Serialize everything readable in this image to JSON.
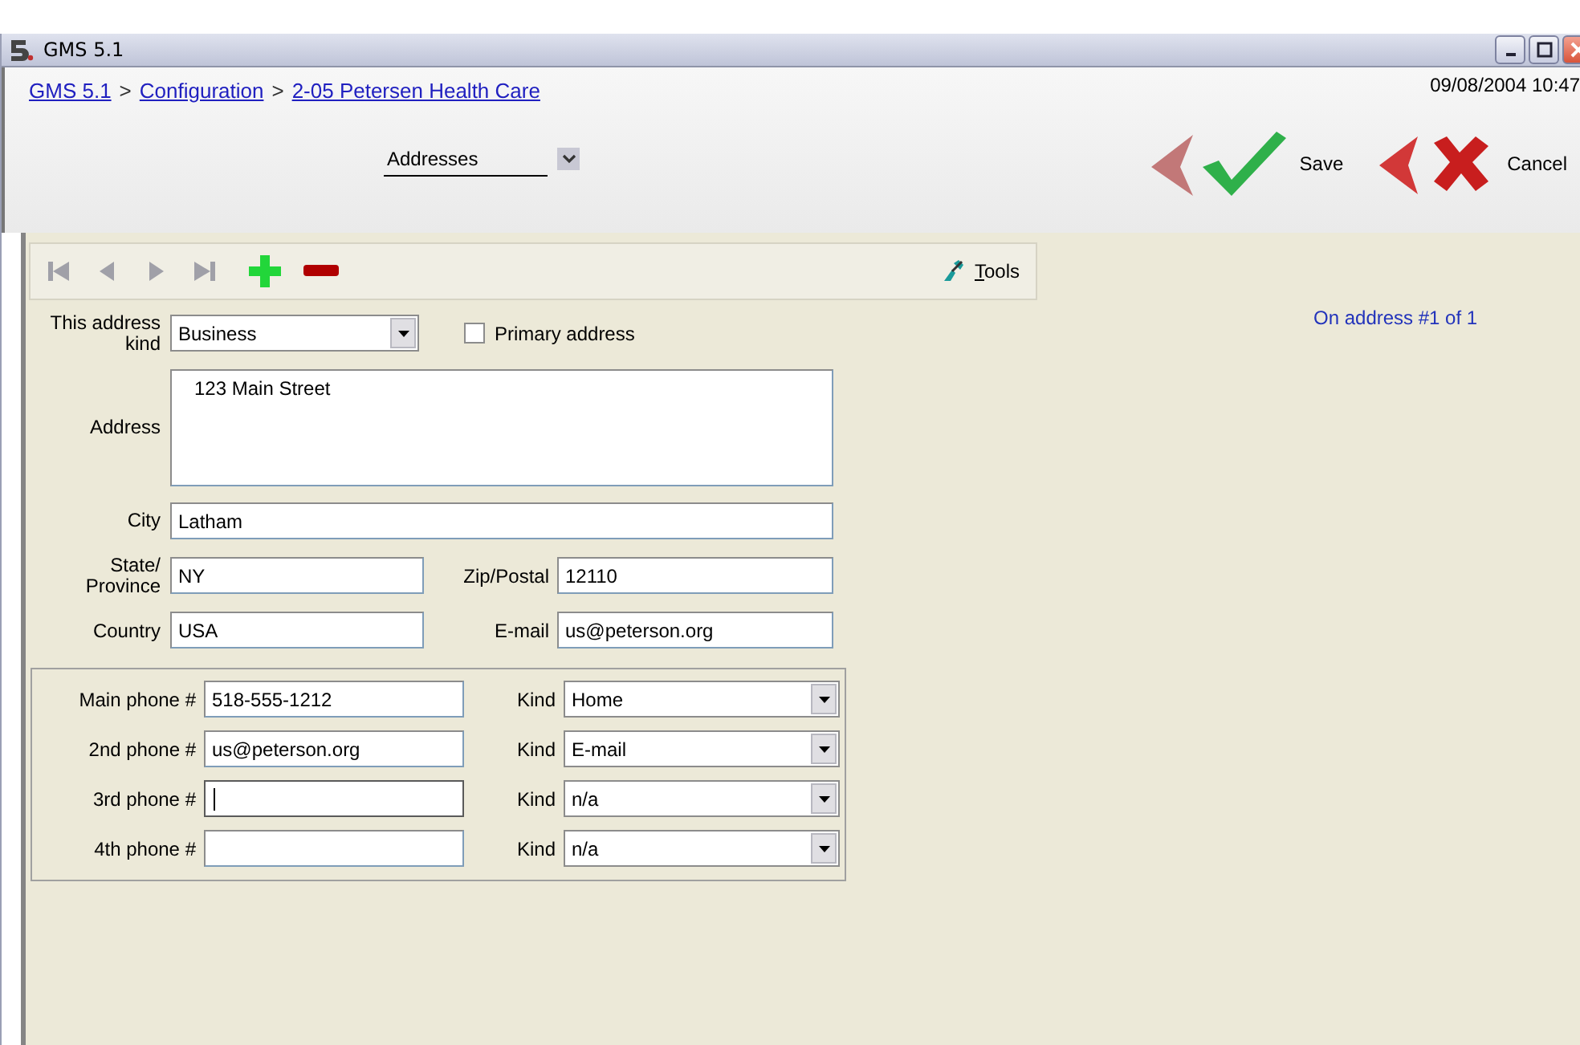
{
  "window": {
    "title": "GMS 5.1"
  },
  "header": {
    "breadcrumb": [
      {
        "kind": "link",
        "text": "GMS 5.1"
      },
      {
        "kind": "separator",
        "text": ">"
      },
      {
        "kind": "link",
        "text": "Configuration"
      },
      {
        "kind": "separator",
        "text": ">"
      },
      {
        "kind": "link",
        "text": "2-05 Petersen Health Care"
      }
    ],
    "section_select": {
      "value": "Addresses"
    },
    "datetime": "09/08/2004 10:47",
    "actions": [
      {
        "kind": "save",
        "label": "Save"
      },
      {
        "kind": "cancel",
        "label": "Cancel"
      }
    ]
  },
  "toolbar": {
    "nav": [
      {
        "kind": "first",
        "disabled": true
      },
      {
        "kind": "previous",
        "disabled": true
      },
      {
        "kind": "next",
        "disabled": true
      },
      {
        "kind": "last",
        "disabled": true
      }
    ],
    "tools": {
      "label": "Tools"
    }
  },
  "record_position": "On address #1 of 1",
  "form": {
    "address_kind": {
      "label": "This address kind",
      "value": "Business"
    },
    "primary_address": {
      "label": "Primary address",
      "checked": false
    },
    "address": {
      "label": "Address",
      "value": "123 Main Street"
    },
    "city": {
      "label": "City",
      "value": "Latham"
    },
    "state": {
      "label": "State/ Province",
      "value": "NY"
    },
    "zip": {
      "label": "Zip/Postal",
      "value": "12110"
    },
    "country": {
      "label": "Country",
      "value": "USA"
    },
    "email": {
      "label": "E-mail",
      "value": "us@peterson.org"
    },
    "phones": [
      {
        "label": "Main phone #",
        "value": "518-555-1212",
        "focused": false,
        "kind_label": "Kind",
        "kind_value": "Home"
      },
      {
        "label": "2nd phone #",
        "value": "us@peterson.org",
        "focused": false,
        "kind_label": "Kind",
        "kind_value": "E-mail"
      },
      {
        "label": "3rd phone #",
        "focused": true,
        "kind_label": "Kind",
        "kind_value": "n/a"
      },
      {
        "label": "4th phone #",
        "focused": false,
        "kind_label": "Kind",
        "kind_value": "n/a"
      }
    ]
  }
}
